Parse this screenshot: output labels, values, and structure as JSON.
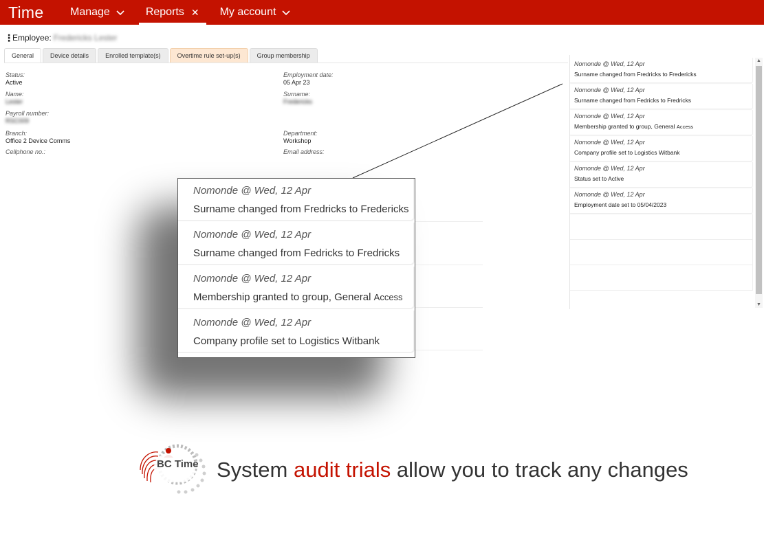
{
  "colors": {
    "brand": "#c41200",
    "tab_highlight": "#fde7d2"
  },
  "nav": {
    "brand": "Time",
    "items": [
      {
        "label": "Manage",
        "icon": "chevron-down-icon"
      },
      {
        "label": "Reports",
        "icon": "close-icon"
      },
      {
        "label": "My account",
        "icon": "chevron-down-icon"
      }
    ]
  },
  "employee": {
    "label": "Employee:",
    "name": "Fredericks Lester"
  },
  "tabs": [
    {
      "label": "General"
    },
    {
      "label": "Device details"
    },
    {
      "label": "Enrolled template(s)"
    },
    {
      "label": "Overtime rule set-up(s)"
    },
    {
      "label": "Group membership"
    }
  ],
  "fields": {
    "status_label": "Status:",
    "status_value": "Active",
    "employment_date_label": "Employment date:",
    "employment_date_value": "05 Apr 23",
    "name_label": "Name:",
    "name_value": "Lester",
    "surname_label": "Surname:",
    "surname_value": "Fredericks",
    "payroll_label": "Payroll number:",
    "payroll_value": "RSC009",
    "branch_label": "Branch:",
    "branch_value": "Office 2 Device Comms",
    "department_label": "Department:",
    "department_value": "Workshop",
    "cellphone_label": "Cellphone no.:",
    "email_label": "Email address:"
  },
  "audit": [
    {
      "who": "Nomonde @ Wed, 12 Apr",
      "what": "Surname changed from Fredricks to Fredericks"
    },
    {
      "who": "Nomonde @ Wed, 12 Apr",
      "what": "Surname changed from Fedricks to Fredricks"
    },
    {
      "who": "Nomonde @ Wed, 12 Apr",
      "what": "Membership granted to group, General",
      "what_extra": "Access"
    },
    {
      "who": "Nomonde @ Wed, 12 Apr",
      "what": "Company profile set to Logistics Witbank"
    },
    {
      "who": "Nomonde @ Wed, 12 Apr",
      "what": "Status set to Active"
    },
    {
      "who": "Nomonde @ Wed, 12 Apr",
      "what": "Employment date set to 05/04/2023"
    }
  ],
  "logo": {
    "text": "BC Time",
    "icon": "bc-time-logo"
  },
  "slogan": {
    "pre": "System",
    "accent": "audit trials",
    "post": "allow you to track any changes"
  }
}
